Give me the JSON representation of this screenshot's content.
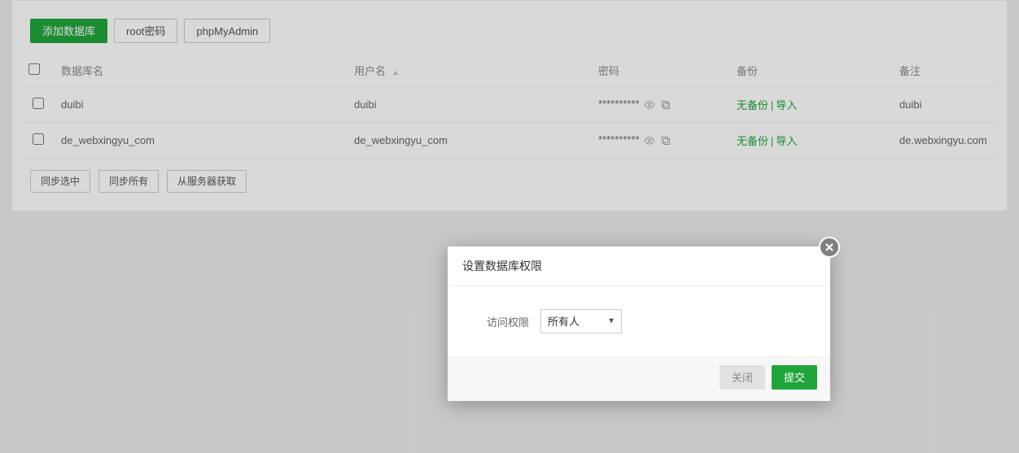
{
  "toolbar": {
    "add_db": "添加数据库",
    "root_pwd": "root密码",
    "phpmyadmin": "phpMyAdmin"
  },
  "table": {
    "headers": {
      "name": "数据库名",
      "user": "用户名",
      "password": "密码",
      "backup": "备份",
      "remark": "备注"
    },
    "rows": [
      {
        "name": "duibi",
        "user": "duibi",
        "password": "**********",
        "backup_none": "无备份",
        "backup_import": "导入",
        "remark": "duibi"
      },
      {
        "name": "de_webxingyu_com",
        "user": "de_webxingyu_com",
        "password": "**********",
        "backup_none": "无备份",
        "backup_import": "导入",
        "remark": "de.webxingyu.com"
      }
    ]
  },
  "footer": {
    "sync_selected": "同步选中",
    "sync_all": "同步所有",
    "fetch_server": "从服务器获取"
  },
  "dialog": {
    "title": "设置数据库权限",
    "label_access": "访问权限",
    "option_everyone": "所有人",
    "close": "关闭",
    "submit": "提交"
  }
}
